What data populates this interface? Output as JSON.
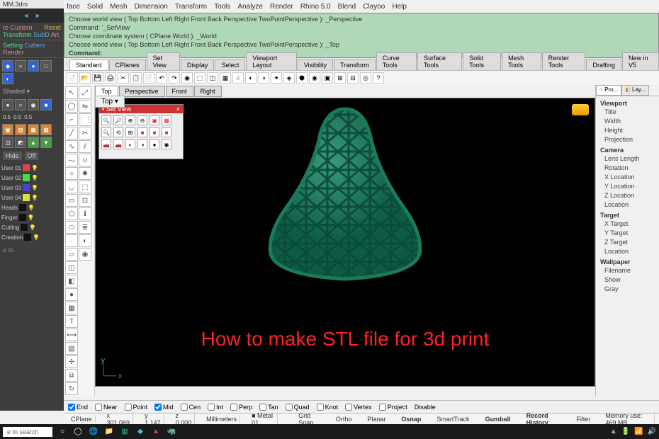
{
  "titlebar": {
    "filename": "MM.3dm"
  },
  "menubar": {
    "items": [
      "Solid",
      "Mesh",
      "Dimension",
      "Transform",
      "Tools",
      "Analyze",
      "Render",
      "Rhino 5.0",
      "Blend",
      "Clayoo",
      "Help"
    ],
    "left_items": [
      "face"
    ]
  },
  "left_sidebar": {
    "nav": {
      "back": "◄",
      "fwd": "►"
    },
    "section1": {
      "custom_label": "re Custom",
      "reset": "Reset",
      "transform": "Transform",
      "subd": "SubD",
      "art": "Art"
    },
    "sub": {
      "setting": "Setting",
      "cutters": "Cutters",
      "render": "Render"
    },
    "layers": [
      {
        "name": "User 01",
        "color": "red"
      },
      {
        "name": "User 02",
        "color": "grn"
      },
      {
        "name": "User 03",
        "color": "blu"
      },
      {
        "name": "User 04",
        "color": "yel"
      },
      {
        "name": "Heads",
        "color": "blk"
      },
      {
        "name": "Finger",
        "color": "blk"
      },
      {
        "name": "Cutting",
        "color": "blk"
      },
      {
        "name": "Creation",
        "color": "blk"
      }
    ],
    "shaded_label": "Shaded",
    "hide_label": "Hide",
    "off_label": "Off",
    "scale_x": "0.5",
    "scale_y": "0.5",
    "scale_z": "0.5",
    "bottom_label": "e to"
  },
  "command": {
    "line1": "Choose world view ( Top  Bottom  Left  Right  Front  Back  Perspective  TwoPointPerspective ): _Perspective",
    "line2": "Command: '_SetView",
    "line3": "Choose coordinate system ( CPlane  World ): _World",
    "line4": "Choose world view ( Top  Bottom  Left  Right  Front  Back  Perspective  TwoPointPerspective ): _Top",
    "prompt": "Command:"
  },
  "tabs": [
    "Standard",
    "CPlanes",
    "Set View",
    "Display",
    "Select",
    "Viewport Layout",
    "Visibility",
    "Transform",
    "Curve Tools",
    "Surface Tools",
    "Solid Tools",
    "Mesh Tools",
    "Render Tools",
    "Drafting",
    "New in V5"
  ],
  "active_tab": "Standard",
  "viewport_tabs": [
    "Top",
    "Perspective",
    "Front",
    "Right"
  ],
  "active_vp_tab": "Top",
  "vp_sub": "Top",
  "vp_arrow": "▾",
  "viewport_label": "",
  "overlay": "How to make STL file for 3d print",
  "setview": {
    "title": "Set View",
    "close": "×"
  },
  "props": {
    "tabs": [
      {
        "icon": "○",
        "label": "Pro..."
      },
      {
        "icon": "◧",
        "label": "Lay..."
      }
    ],
    "groups": [
      {
        "hdr": "Viewport",
        "rows": [
          "Title",
          "Width",
          "Height",
          "Projection"
        ]
      },
      {
        "hdr": "Camera",
        "rows": [
          "Lens Length",
          "Rotation",
          "X Location",
          "Y Location",
          "Z Location",
          "Location"
        ]
      },
      {
        "hdr": "Target",
        "rows": [
          "X Target",
          "Y Target",
          "Z Target",
          "Location"
        ]
      },
      {
        "hdr": "Wallpaper",
        "rows": [
          "Filename",
          "Show",
          "Gray"
        ]
      }
    ]
  },
  "osnap": {
    "items": [
      {
        "label": "End",
        "checked": true
      },
      {
        "label": "Near",
        "checked": false
      },
      {
        "label": "Point",
        "checked": false
      },
      {
        "label": "Mid",
        "checked": true
      },
      {
        "label": "Cen",
        "checked": false
      },
      {
        "label": "Int",
        "checked": false
      },
      {
        "label": "Perp",
        "checked": false
      },
      {
        "label": "Tan",
        "checked": false
      },
      {
        "label": "Quad",
        "checked": false
      },
      {
        "label": "Knot",
        "checked": false
      },
      {
        "label": "Vertex",
        "checked": false
      }
    ],
    "project": "Project",
    "disable": "Disable"
  },
  "status": {
    "cplane": "CPlane",
    "x": "x 301.069",
    "y": "y 1.147",
    "z": "z 0.000",
    "units": "Millimeters",
    "layer": "■ Metal 01",
    "modes": [
      "Grid Snap",
      "Ortho",
      "Planar",
      "Osnap",
      "SmartTrack",
      "Gumball",
      "Record History",
      "Filter"
    ],
    "active_modes": [
      "Osnap",
      "Gumball",
      "Record History"
    ],
    "memory": "Memory use: 469 MB"
  },
  "taskbar": {
    "search_placeholder": "e to search",
    "sys": [
      "▲",
      "🔋",
      "📶",
      "🔊"
    ]
  }
}
